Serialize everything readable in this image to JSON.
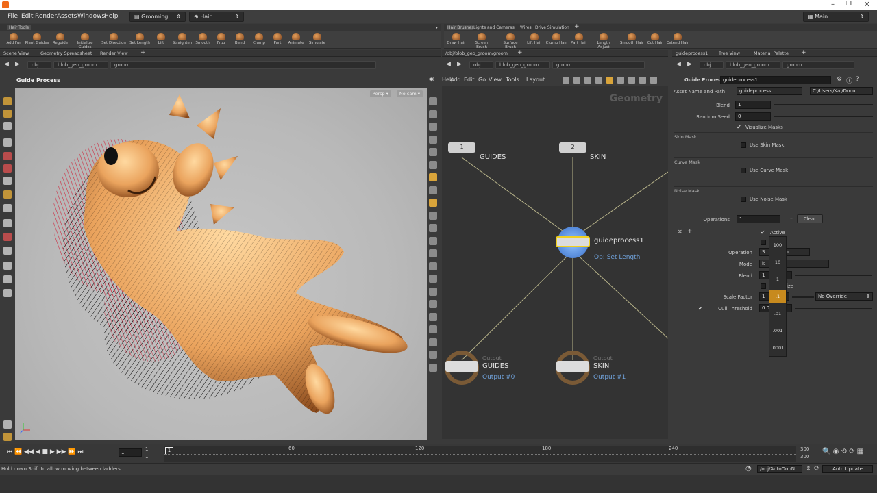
{
  "menu": {
    "items": [
      "File",
      "Edit",
      "Render",
      "Assets",
      "Windows",
      "Help"
    ],
    "desktop": "Grooming",
    "context": "Hair",
    "main": "Main"
  },
  "shelf_left": {
    "tab": "Hair Tools",
    "tools": [
      "Add Fur",
      "Plant Guides",
      "Reguide",
      "Initialize Guides",
      "Set Direction",
      "Set Length",
      "Lift",
      "Straighten",
      "Smooth",
      "Frizz",
      "Bend",
      "Clump",
      "Part",
      "Animate",
      "Simulate"
    ]
  },
  "shelf_right": {
    "tabs": [
      "Hair Brushes",
      "Lights and Cameras",
      "Wires",
      "Drive Simulation"
    ],
    "tools": [
      "Draw Hair",
      "Screen Brush",
      "Surface Brush",
      "Lift Hair",
      "Clump Hair",
      "Part Hair",
      "Length Adjust",
      "Smooth Hair",
      "Cut Hair",
      "Extend Hair"
    ]
  },
  "left_pane": {
    "tabs": [
      "Scene View",
      "Geometry Spreadsheet",
      "Render View"
    ],
    "crumbs": [
      "obj",
      "blob_geo_groom",
      "groom"
    ],
    "title": "Guide Process",
    "persp": "Persp ▾",
    "cam": "No cam ▾"
  },
  "mid_pane": {
    "tab": "/obj/blob_geo_groom/groom",
    "crumbs": [
      "obj",
      "blob_geo_groom",
      "groom"
    ],
    "menu": [
      "Add",
      "Edit",
      "Go",
      "View",
      "Tools",
      "Layout",
      "Help"
    ],
    "context_label": "Geometry",
    "nodes": {
      "in1": {
        "num": "1",
        "label": "GUIDES"
      },
      "in2": {
        "num": "2",
        "label": "SKIN"
      },
      "proc": {
        "label": "guideprocess1",
        "sub": "Op: Set Length"
      },
      "out1": {
        "tag": "Output",
        "label": "GUIDES",
        "sub": "Output #0"
      },
      "out2": {
        "tag": "Output",
        "label": "SKIN",
        "sub": "Output #1"
      }
    }
  },
  "right_pane": {
    "tabs": [
      "guideprocess1",
      "Tree View",
      "Material Palette"
    ],
    "crumbs": [
      "obj",
      "blob_geo_groom",
      "groom"
    ],
    "node_type": "Guide Process",
    "node_name": "guideprocess1",
    "asset_label": "Asset Name and Path",
    "asset_name": "guideprocess",
    "asset_path": "C:/Users/Kai/Docu...",
    "blend_label": "Blend",
    "blend": "1",
    "seed_label": "Random Seed",
    "seed": "0",
    "visualize": "Visualize Masks",
    "skin_mask": "Skin Mask",
    "use_skin": "Use Skin Mask",
    "curve_mask": "Curve Mask",
    "use_curve": "Use Curve Mask",
    "noise_mask": "Noise Mask",
    "use_noise": "Use Noise Mask",
    "ops_label": "Operations",
    "ops": "1",
    "clear": "Clear",
    "active": "Active",
    "operation_label": "Operation",
    "operation_frag": "S",
    "operation_frag2": "h",
    "mode_label": "Mode",
    "mode_frag": "k",
    "blend2_label": "Blend",
    "blend2": "1",
    "size_frag": "ize",
    "scale_label": "Scale Factor",
    "scale": "1",
    "override": "No Override",
    "cull_label": "Cull Threshold",
    "cull": "0.0"
  },
  "ladder": [
    "100",
    "10",
    "1",
    ".1",
    ".01",
    ".001",
    ".0001"
  ],
  "timeline": {
    "frame": "1",
    "start": "1",
    "start2": "1",
    "end": "300",
    "end2": "300",
    "ticks": [
      "60",
      "120",
      "180",
      "240"
    ],
    "current": "1"
  },
  "status": {
    "text": "Hold down Shift to allow moving between ladders",
    "path": "/obj/AutoDopN...",
    "update": "Auto Update"
  }
}
